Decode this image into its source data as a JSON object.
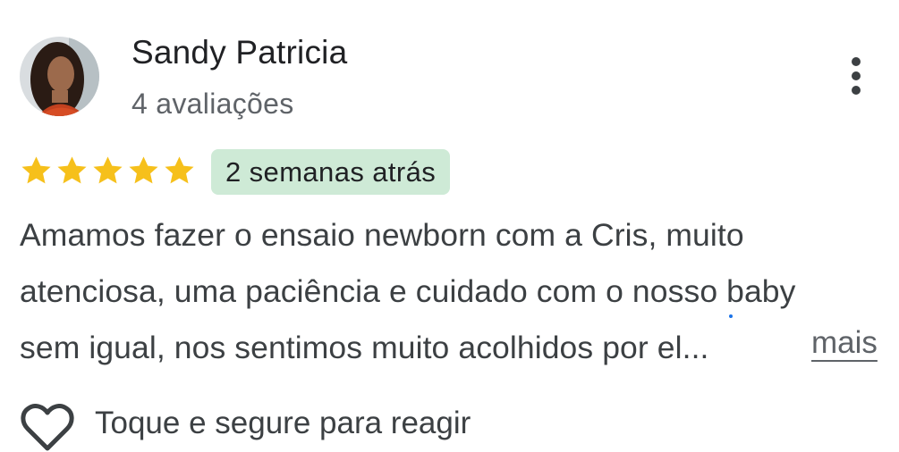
{
  "review": {
    "author_name": "Sandy Patricia",
    "author_reviews": "4 avaliações",
    "rating": 5,
    "rating_max": 5,
    "time_ago": "2 semanas atrás",
    "text_lines": [
      "Amamos fazer o ensaio newborn com a Cris, muito",
      "atenciosa, uma paciência e cuidado com o nosso baby",
      "sem igual, nos sentimos muito acolhidos por el..."
    ],
    "more_label": "mais",
    "react_label": "Toque e segure para reagir"
  },
  "icons": {
    "menu": "more-vert-icon",
    "star": "star-icon",
    "heart": "heart-outline-icon"
  },
  "colors": {
    "star": "#f6c01b",
    "badge_bg": "#ceead6",
    "muted_text": "#5f6368"
  }
}
